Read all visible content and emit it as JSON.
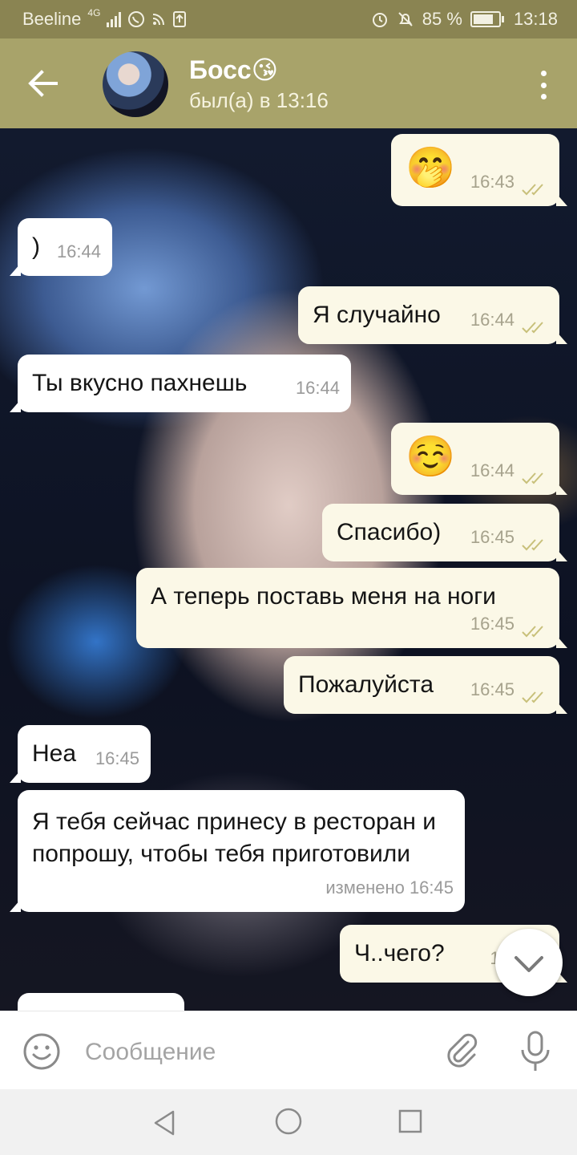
{
  "status_bar": {
    "carrier": "Beeline",
    "network": "4G",
    "battery": "85 %",
    "time": "13:18"
  },
  "header": {
    "name": "Босс😘",
    "status": "был(а) в 13:16"
  },
  "messages": [
    {
      "dir": "out",
      "emoji": "🤭",
      "time": "16:43",
      "read": true
    },
    {
      "dir": "in",
      "text": ")",
      "time": "16:44"
    },
    {
      "dir": "out",
      "text": "Я случайно",
      "time": "16:44",
      "read": true
    },
    {
      "dir": "in",
      "text": "Ты вкусно пахнешь",
      "time": "16:44"
    },
    {
      "dir": "out",
      "emoji": "☺️",
      "time": "16:44",
      "read": true
    },
    {
      "dir": "out",
      "text": "Спасибо)",
      "time": "16:45",
      "read": true
    },
    {
      "dir": "out",
      "text": "А теперь поставь меня на ноги",
      "time": "16:45",
      "read": true
    },
    {
      "dir": "out",
      "text": "Пожалуйста",
      "time": "16:45",
      "read": true
    },
    {
      "dir": "in",
      "text": "Неа",
      "time": "16:45"
    },
    {
      "dir": "in",
      "text": "Я тебя сейчас принесу в ресторан и попрошу, чтобы тебя приготовили",
      "time": "изменено 16:45"
    },
    {
      "dir": "out",
      "text": "Ч..чего?",
      "time": "16:",
      "read": true
    }
  ],
  "input": {
    "placeholder": "Сообщение"
  },
  "colors": {
    "header": "#a8a36a",
    "status_bar": "#8a8452",
    "outgoing_bubble": "#fbf8e7",
    "incoming_bubble": "#ffffff",
    "read_ticks": "#c8c07a"
  },
  "icons": {
    "back": "arrow-left-icon",
    "menu": "more-vertical-icon",
    "emoji": "smiley-icon",
    "attach": "paperclip-icon",
    "mic": "microphone-icon",
    "scroll": "chevron-down-icon"
  }
}
